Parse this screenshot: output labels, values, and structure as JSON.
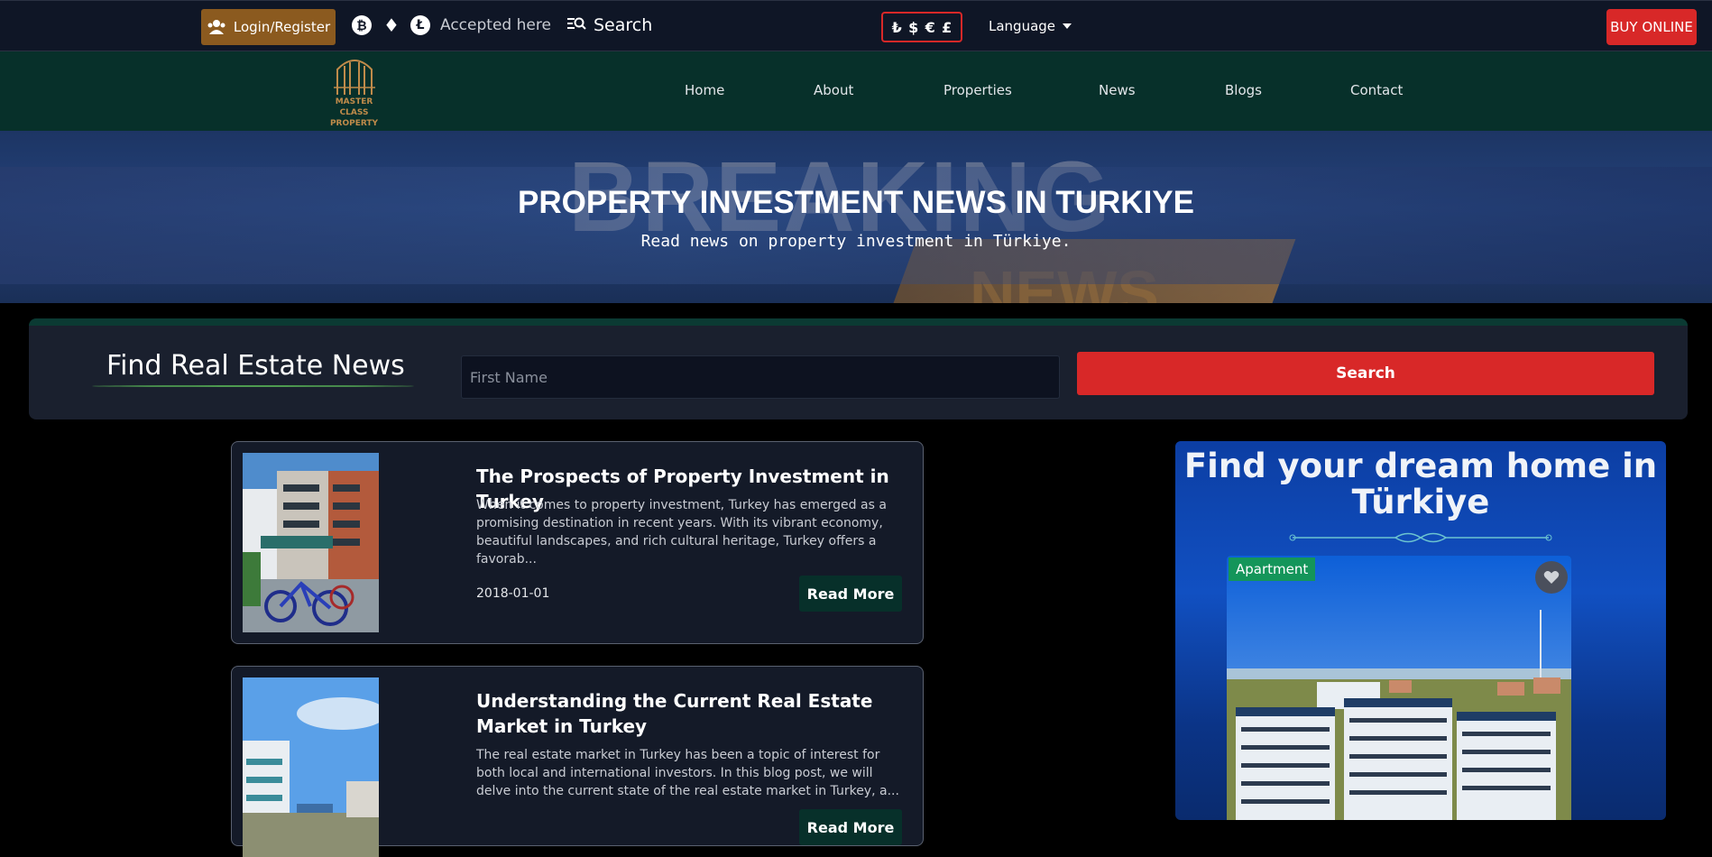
{
  "topbar": {
    "login_label": "Login/Register",
    "crypto_icons": [
      "bitcoin-icon",
      "ethereum-icon",
      "litecoin-icon"
    ],
    "accepted_label": "Accepted here",
    "search_label": "Search",
    "currencies": [
      "₺",
      "$",
      "€",
      "£"
    ],
    "language_label": "Language",
    "buy_label": "BUY ONLINE"
  },
  "logo": {
    "line1": "MASTER CLASS",
    "line2": "PROPERTY"
  },
  "nav": [
    "Home",
    "About",
    "Properties",
    "News",
    "Blogs",
    "Contact"
  ],
  "hero": {
    "background_word_1": "BREAKING",
    "background_word_2": "NEWS",
    "title": "PROPERTY INVESTMENT NEWS IN TURKIYE",
    "subtitle": "Read news on property investment in Türkiye."
  },
  "find": {
    "title": "Find Real Estate News",
    "placeholder": "First Name",
    "button_label": "Search"
  },
  "articles": [
    {
      "title": "The Prospects of Property Investment in Turkey",
      "excerpt": "When it comes to property investment, Turkey has emerged as a promising destination in recent years. With its vibrant economy, beautiful landscapes, and rich cultural heritage, Turkey offers a favorab...",
      "date": "2018-01-01",
      "button": "Read More"
    },
    {
      "title": "Understanding the Current Real Estate Market in Turkey",
      "excerpt": "The real estate market in Turkey has been a topic of interest for both local and international investors. In this blog post, we will delve into the current state of the real estate market in Turkey, a...",
      "button": "Read More"
    }
  ],
  "dream": {
    "title": "Find your dream home in Türkiye",
    "badge": "Apartment"
  },
  "colors": {
    "accent_red": "#d82828",
    "dark_green": "#07302a",
    "brown": "#8b5a1f",
    "badge_green": "#14955a"
  }
}
